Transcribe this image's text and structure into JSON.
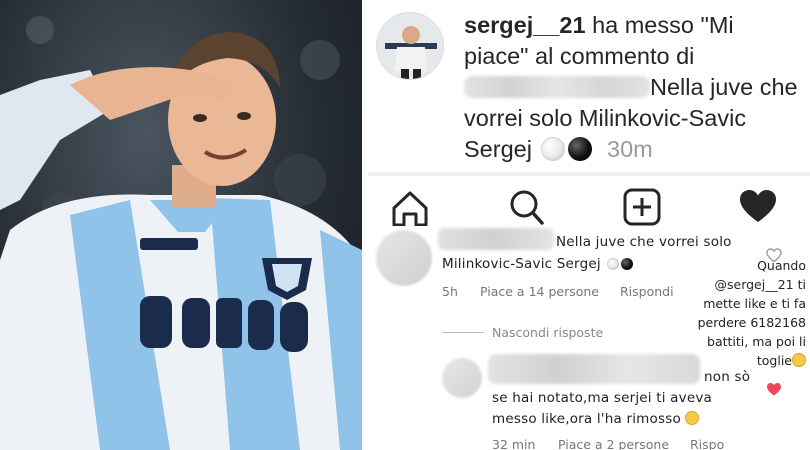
{
  "notification": {
    "username": "sergej__21",
    "action_text": "ha messo \"Mi piace\" al commento di",
    "comment_text": "Nella juve che vorrei solo Milinkovic-Savic Sergej",
    "time": "30m"
  },
  "tabbar": {
    "icons": [
      "home-icon",
      "search-icon",
      "add-post-icon",
      "heart-filled-icon"
    ]
  },
  "comment_main": {
    "text_line1": "Nella juve che vorrei solo",
    "text_line2": "Milinkovic-Savic Sergej",
    "time": "5h",
    "likes": "Piace a 14 persone",
    "reply": "Rispondi"
  },
  "annotation": {
    "line1": "Quando",
    "mention": "@sergej__21",
    "line2": "ti",
    "line3": "mette like e ti fa",
    "line4": "perdere 6182168",
    "line5": "battiti, ma poi li",
    "line6": "toglie"
  },
  "hide_replies": "Nascondi risposte",
  "comment_reply": {
    "text_line1": "non sò",
    "text_line2": "se hai notato,ma serjei ti aveva",
    "text_line3": "messo like,ora l'ha rimosso",
    "time": "32 min",
    "likes": "Piace a 2 persone",
    "reply": "Rispo"
  },
  "colors": {
    "lazio_sky_blue": "#8fc3ea",
    "lazio_navy": "#1a2b4c",
    "like_red": "#ed4956",
    "text_dark": "#262626",
    "text_muted": "#999999"
  }
}
